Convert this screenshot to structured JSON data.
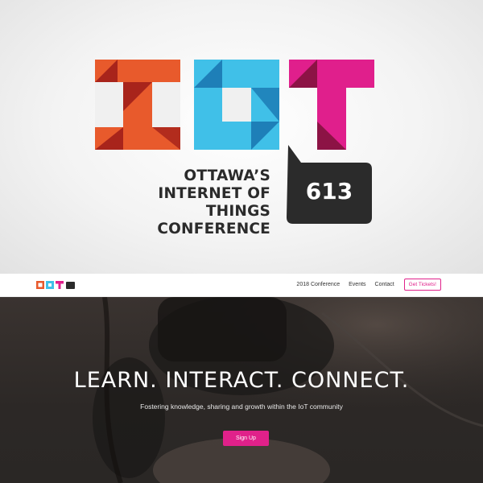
{
  "brand": {
    "logo_letters": "IOT",
    "tagline_lines": [
      "OTTAWA’S",
      "INTERNET OF THINGS",
      "CONFERENCE"
    ],
    "bubble_text": "613",
    "colors": {
      "orange": "#e85a2c",
      "orange_dark": "#a8241b",
      "cyan": "#40c0e8",
      "cyan_dark": "#1e7fb8",
      "magenta": "#e01f8c",
      "magenta_dark": "#8c1345",
      "bubble": "#2b2b2b"
    }
  },
  "nav": {
    "logo_badge": "613",
    "links": [
      "2018 Conference",
      "Events",
      "Contact"
    ],
    "cta": "Get Tickets!"
  },
  "hero": {
    "title": "LEARN. INTERACT. CONNECT.",
    "subtitle": "Fostering knowledge, sharing and growth within the IoT community",
    "button": "Sign Up",
    "accent": "#e0218a"
  }
}
